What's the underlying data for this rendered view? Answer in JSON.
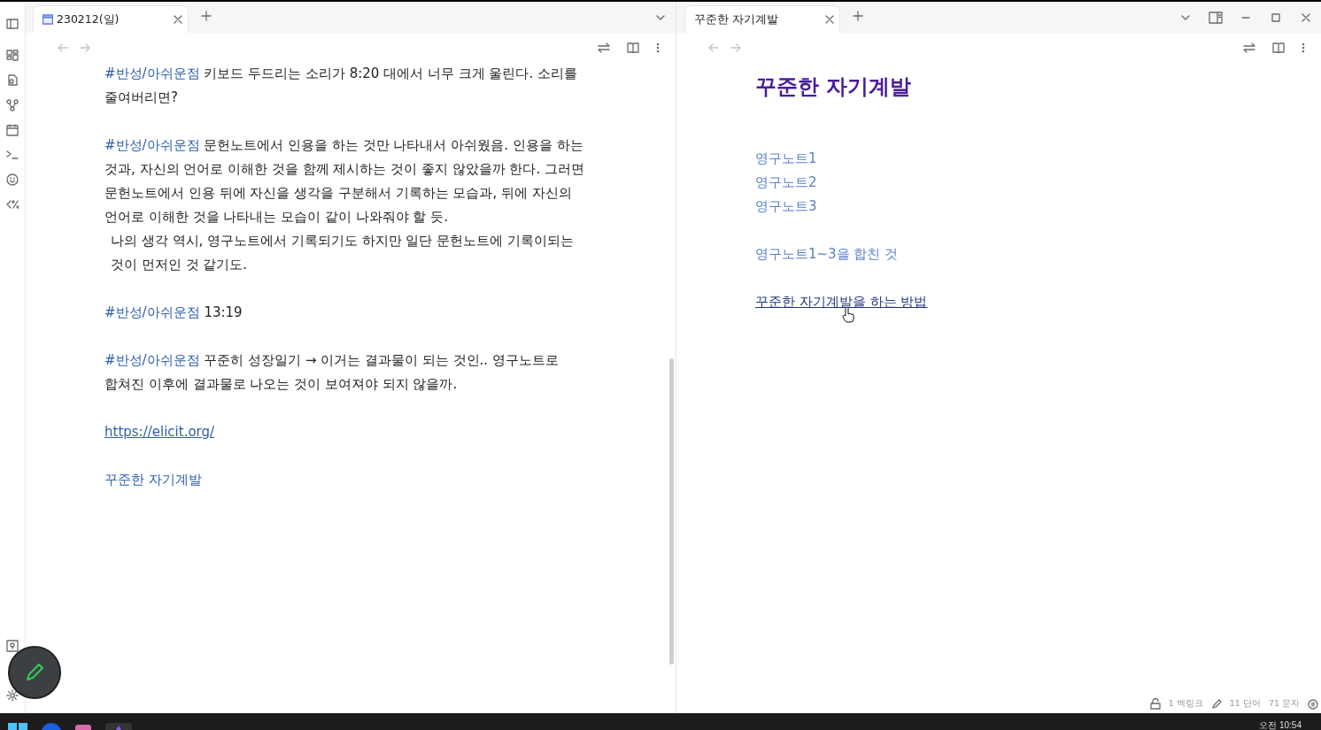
{
  "panes": [
    {
      "tabs": [
        {
          "label": "230212(일)",
          "kind": "daily-note",
          "selected": true
        }
      ],
      "blocks": [
        {
          "kind": "tagged",
          "tag": "#반성/아쉬운점",
          "text": " 키보드 두드리는 소리가 8:20 대에서 너무 크게 울린다. 소리를 줄여버리면?"
        },
        {
          "kind": "tagged",
          "tag": "#반성/아쉬운점",
          "text": " 문헌노트에서 인용을 하는 것만 나타내서 아쉬웠음. 인용을 하는 것과, 자신의 언어로 이해한 것을 함께 제시하는 것이 좋지 않았을까 한다. 그러면 문헌노트에서 인용 뒤에 자신을 생각을 구분해서 기록하는 모습과, 뒤에 자신의 언어로 이해한 것을 나타내는 모습이 같이 나와줘야 할 듯."
        },
        {
          "kind": "indented",
          "text": "나의 생각 역시, 영구노트에서 기록되기도 하지만 일단 문헌노트에 기록이되는 것이 먼저인 것 같기도."
        },
        {
          "kind": "tagged",
          "tag": "#반성/아쉬운점",
          "text": " 13:19"
        },
        {
          "kind": "tagged",
          "tag": "#반성/아쉬운점",
          "text": " 꾸준히 성장일기 → 이거는 결과물이 되는 것인.. 영구노트로 합쳐진 이후에 결과물로 나오는 것이 보여져야 되지 않을까."
        },
        {
          "kind": "url",
          "text": "https://elicit.org/"
        },
        {
          "kind": "internal",
          "text": "꾸준한 자기계발"
        }
      ]
    },
    {
      "tabs": [
        {
          "label": "꾸준한 자기계발",
          "kind": "note",
          "selected": true
        }
      ],
      "title": "꾸준한 자기계발",
      "link_groups": [
        {
          "links": [
            {
              "label": "영구노트1",
              "hovered": false
            },
            {
              "label": "영구노트2",
              "hovered": false
            },
            {
              "label": "영구노트3",
              "hovered": false
            }
          ]
        },
        {
          "links": [
            {
              "label": "영구노트1~3을 합친 것",
              "hovered": false
            }
          ]
        },
        {
          "links": [
            {
              "label": "꾸준한 자기계발을 하는 방법",
              "hovered": true
            }
          ]
        }
      ],
      "status_bar": {
        "backlinks": "1 백링크",
        "words": "11 단어",
        "chars": "71 문자"
      }
    }
  ],
  "taskbar": {
    "clock": "오전 10:54"
  }
}
